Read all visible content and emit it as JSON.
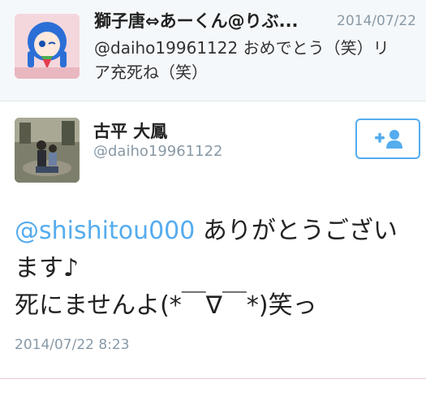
{
  "reply": {
    "name": "獅子唐⇔あーくん@りぶ...",
    "date": "2014/07/22",
    "line1": "@daiho19961122 おめでとう（笑）リ",
    "line2": "ア充死ね（笑）"
  },
  "tweet": {
    "name": "古平 大鳳",
    "handle": "@daiho19961122",
    "mention": "@shishitou000",
    "text1": " ありがとうござい",
    "text2": "ます♪",
    "text3": "死にませんよ(*￣∇￣*)笑っ",
    "timestamp": "2014/07/22 8:23"
  },
  "icons": {
    "follow": "add-user-icon"
  },
  "colors": {
    "accent": "#55acee",
    "muted": "#8899a6"
  }
}
